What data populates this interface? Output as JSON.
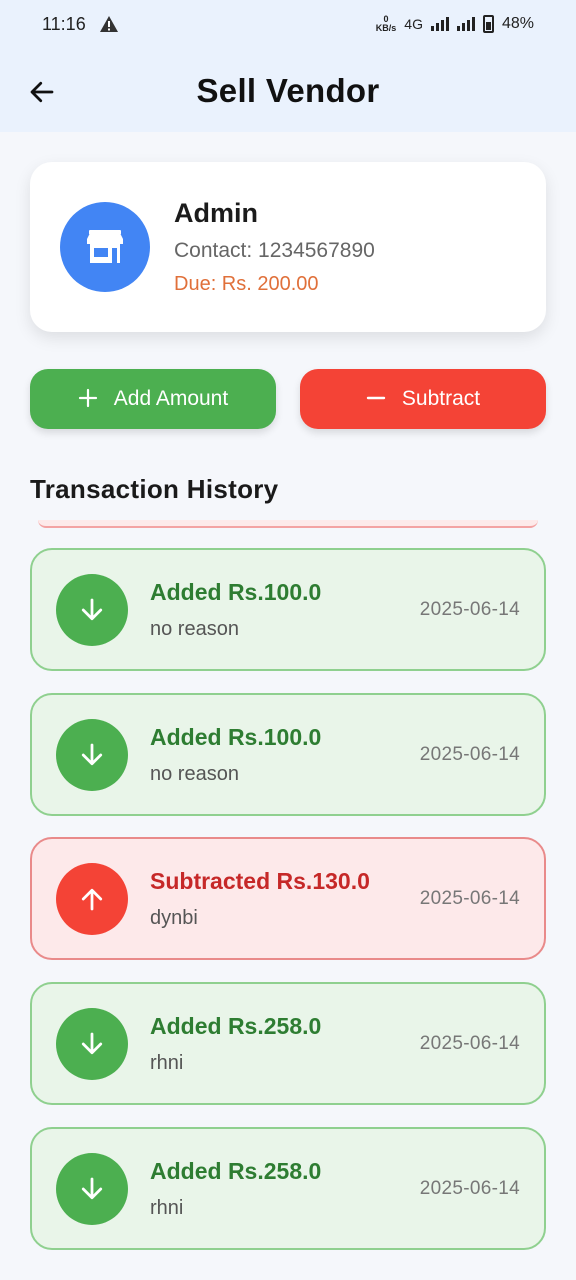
{
  "status_bar": {
    "time": "11:16",
    "warning_icon": "warning-triangle-icon",
    "speed_value": "0",
    "speed_unit": "KB/s",
    "network": "4G",
    "battery": "48%"
  },
  "header": {
    "back_icon": "arrow-left-icon",
    "title": "Sell Vendor"
  },
  "vendor": {
    "icon": "store-icon",
    "name": "Admin",
    "contact": "Contact: 1234567890",
    "due": "Due: Rs. 200.00"
  },
  "actions": {
    "add_label": "Add Amount",
    "add_icon": "plus-icon",
    "subtract_label": "Subtract",
    "subtract_icon": "minus-icon"
  },
  "history": {
    "title": "Transaction History",
    "transactions": [
      {
        "type": "add",
        "title": "Added Rs.100.0",
        "reason": "no reason",
        "date": "2025-06-14",
        "icon": "arrow-down-icon"
      },
      {
        "type": "add",
        "title": "Added Rs.100.0",
        "reason": "no reason",
        "date": "2025-06-14",
        "icon": "arrow-down-icon"
      },
      {
        "type": "subtract",
        "title": "Subtracted Rs.130.0",
        "reason": "dynbi",
        "date": "2025-06-14",
        "icon": "arrow-up-icon"
      },
      {
        "type": "add",
        "title": "Added Rs.258.0",
        "reason": "rhni",
        "date": "2025-06-14",
        "icon": "arrow-down-icon"
      },
      {
        "type": "add",
        "title": "Added Rs.258.0",
        "reason": "rhni",
        "date": "2025-06-14",
        "icon": "arrow-down-icon"
      }
    ]
  },
  "colors": {
    "add": "#4caf50",
    "subtract": "#f44336",
    "avatar": "#4285f4",
    "due": "#e0703a"
  }
}
